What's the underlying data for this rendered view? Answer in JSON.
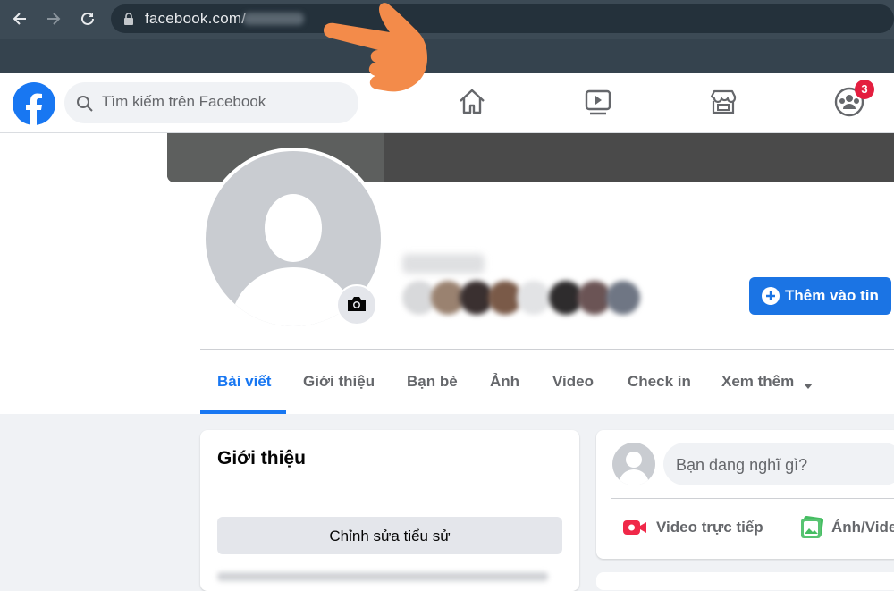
{
  "browser": {
    "url": "facebook.com/",
    "back_icon": "arrow-left-icon",
    "forward_icon": "arrow-right-icon",
    "reload_icon": "reload-icon",
    "lock_icon": "lock-icon"
  },
  "header": {
    "logo": "facebook-logo",
    "search_placeholder": "Tìm kiếm trên Facebook",
    "nav_icons": [
      "home-icon",
      "watch-icon",
      "marketplace-icon",
      "groups-icon"
    ],
    "groups_badge": "3"
  },
  "profile": {
    "add_story_label": "Thêm vào tin",
    "tabs": [
      "Bài viết",
      "Giới thiệu",
      "Bạn bè",
      "Ảnh",
      "Video",
      "Check in",
      "Xem thêm"
    ],
    "active_tab": "Bài viết"
  },
  "intro": {
    "title": "Giới thiệu",
    "edit_bio_label": "Chỉnh sửa tiểu sử"
  },
  "composer": {
    "placeholder": "Bạn đang nghĩ gì?",
    "live_label": "Video trực tiếp",
    "photo_label": "Ảnh/Vide"
  },
  "colors": {
    "brand_blue": "#1877f2",
    "badge_red": "#e41e3f",
    "browser_bar": "#35434e",
    "hand_orange": "#f38b4a"
  }
}
